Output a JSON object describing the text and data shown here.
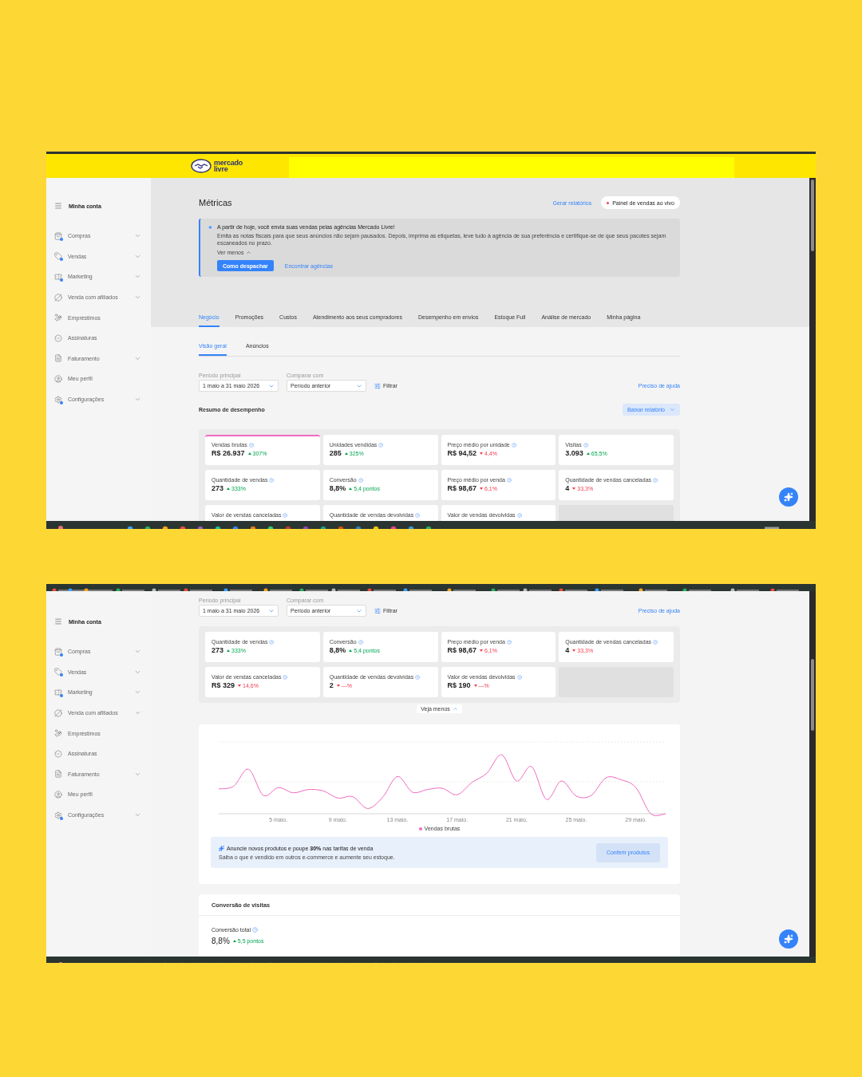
{
  "screens": [
    {
      "kind": "top",
      "logo": {
        "line_1": "mercado",
        "line_2": "livre"
      },
      "sidebar": {
        "title": "Minha conta",
        "items": [
          {
            "label": "Compras",
            "expandable": true,
            "badge": true
          },
          {
            "label": "Vendas",
            "expandable": true,
            "badge": true
          },
          {
            "label": "Marketing",
            "expandable": true,
            "badge": true
          },
          {
            "label": "Venda com afiliados",
            "expandable": true,
            "badge": false
          },
          {
            "label": "Empréstimos",
            "expandable": false,
            "badge": false
          },
          {
            "label": "Assinaturas",
            "expandable": false,
            "badge": false
          },
          {
            "label": "Faturamento",
            "expandable": true,
            "badge": false
          },
          {
            "label": "Meu perfil",
            "expandable": false,
            "badge": false
          },
          {
            "label": "Configurações",
            "expandable": true,
            "badge": true
          }
        ]
      },
      "page_title": "Métricas",
      "report_link": "Gerar relatórios",
      "live_button": "Painel de vendas ao vivo",
      "notice": {
        "title": "A partir de hoje, você envia suas vendas pelas agências Mercado Livre!",
        "body": "Emita as notas fiscais para que seus anúncios não sejam pausados. Depois, imprima as etiquetas, leve tudo à agência de sua preferência e certifique-se de que seus pacotes sejam escaneados no prazo.",
        "toggle": "Ver menos",
        "primary_button": "Como despachar",
        "link": "Encontrar agências"
      },
      "tabs": [
        {
          "label": "Negócio",
          "selected": true
        },
        {
          "label": "Promoções",
          "selected": false
        },
        {
          "label": "Custos",
          "selected": false
        },
        {
          "label": "Atendimento aos seus compradores",
          "selected": false
        },
        {
          "label": "Desempenho em envios",
          "selected": false
        },
        {
          "label": "Estoque Full",
          "selected": false
        },
        {
          "label": "Análise de mercado",
          "selected": false
        },
        {
          "label": "Minha página",
          "selected": false
        }
      ],
      "subtabs": [
        {
          "label": "Visão geral",
          "selected": true
        },
        {
          "label": "Anúncios",
          "selected": false
        }
      ],
      "filters": {
        "main_label": "Período principal",
        "main_value": "1 maio a 31 maio 2026",
        "compare_label": "Comparar com",
        "compare_value": "Período anterior",
        "filter_button": "Filtrar",
        "help_link": "Preciso de ajuda"
      },
      "summary_title": "Resumo de desempenho",
      "download_button": "Baixar relatório",
      "cards": [
        {
          "kind": "metric",
          "title": "Vendas brutas",
          "value": "R$ 26.937",
          "delta": "307%",
          "rising": true,
          "selected": true
        },
        {
          "kind": "metric",
          "title": "Unidades vendidas",
          "value": "285",
          "delta": "325%",
          "rising": true,
          "selected": false
        },
        {
          "kind": "metric",
          "title": "Preço médio por unidade",
          "value": "R$ 94,52",
          "delta": "4,4%",
          "rising": false,
          "selected": false
        },
        {
          "kind": "metric",
          "title": "Visitas",
          "value": "3.093",
          "delta": "65,5%",
          "rising": true,
          "selected": false
        },
        {
          "kind": "metric",
          "title": "Quantidade de vendas",
          "value": "273",
          "delta": "333%",
          "rising": true,
          "selected": false
        },
        {
          "kind": "metric",
          "title": "Conversão",
          "value": "8,8%",
          "delta": "5,4 pontos",
          "rising": true,
          "selected": false
        },
        {
          "kind": "metric",
          "title": "Preço médio por venda",
          "value": "R$ 98,67",
          "delta": "6,1%",
          "rising": false,
          "selected": false
        },
        {
          "kind": "metric",
          "title": "Quantidade de vendas canceladas",
          "value": "4",
          "delta": "33,3%",
          "rising": false,
          "selected": false
        },
        {
          "kind": "metric",
          "title": "Valor de vendas canceladas",
          "selected": false
        },
        {
          "kind": "metric",
          "title": "Quantidade de vendas devolvidas",
          "selected": false
        },
        {
          "kind": "metric",
          "title": "Valor de vendas devolvidas",
          "selected": false
        },
        {
          "kind": "empty"
        }
      ]
    },
    {
      "kind": "scrolled",
      "sidebar": {
        "title": "Minha conta",
        "items": [
          {
            "label": "Compras",
            "expandable": true,
            "badge": true
          },
          {
            "label": "Vendas",
            "expandable": true,
            "badge": true
          },
          {
            "label": "Marketing",
            "expandable": true,
            "badge": true
          },
          {
            "label": "Venda com afiliados",
            "expandable": true,
            "badge": false
          },
          {
            "label": "Empréstimos",
            "expandable": false,
            "badge": false
          },
          {
            "label": "Assinaturas",
            "expandable": false,
            "badge": false
          },
          {
            "label": "Faturamento",
            "expandable": true,
            "badge": false
          },
          {
            "label": "Meu perfil",
            "expandable": false,
            "badge": false
          },
          {
            "label": "Configurações",
            "expandable": true,
            "badge": true
          }
        ]
      },
      "filters": {
        "main_label": "Período principal",
        "main_value": "1 maio a 31 maio 2026",
        "compare_label": "Comparar com",
        "compare_value": "Período anterior",
        "filter_button": "Filtrar",
        "help_link": "Preciso de ajuda"
      },
      "cards": [
        {
          "kind": "metric",
          "title": "Quantidade de vendas",
          "value": "273",
          "delta": "333%",
          "rising": true,
          "selected": false
        },
        {
          "kind": "metric",
          "title": "Conversão",
          "value": "8,8%",
          "delta": "5,4 pontos",
          "rising": true,
          "selected": false
        },
        {
          "kind": "metric",
          "title": "Preço médio por venda",
          "value": "R$ 98,67",
          "delta": "6,1%",
          "rising": false,
          "selected": false
        },
        {
          "kind": "metric",
          "title": "Quantidade de vendas canceladas",
          "value": "4",
          "delta": "33,3%",
          "rising": false,
          "selected": false
        },
        {
          "kind": "metric",
          "title": "Valor de vendas canceladas",
          "value": "R$ 329",
          "delta": "14,6%",
          "rising": false,
          "selected": false
        },
        {
          "kind": "metric",
          "title": "Quantidade de vendas devolvidas",
          "value": "2",
          "delta": "—%",
          "rising": false,
          "selected": false
        },
        {
          "kind": "metric",
          "title": "Valor de vendas devolvidas",
          "value": "R$ 190",
          "delta": "—%",
          "rising": false,
          "selected": false
        },
        {
          "kind": "empty"
        }
      ],
      "toggle": "Veja menos",
      "chart": {
        "x_labels": [
          "5 maio.",
          "9 maio.",
          "13 maio.",
          "17 maio.",
          "21 maio.",
          "25 maio.",
          "29 maio."
        ],
        "legend": "Vendas brutas"
      },
      "promo": {
        "title": "Anuncie novos produtos e poupe **30%** nas tarifas de venda",
        "body": "Saiba o que é vendido em outros e-commerce e aumente seu estoque.",
        "button": "Conferir produtos"
      },
      "conversion": {
        "title": "Conversão de visitas",
        "label": "Conversão total",
        "value": "8,8%",
        "delta": "5,5 pontos",
        "rising": true
      }
    }
  ]
}
